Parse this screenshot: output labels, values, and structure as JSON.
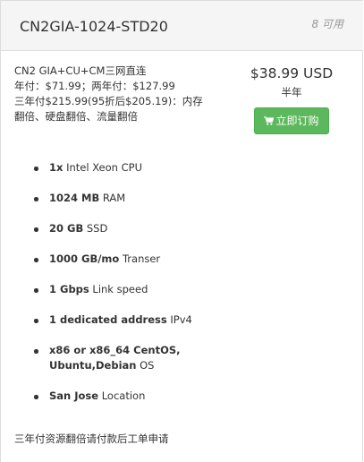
{
  "product": {
    "name": "CN2GIA-1024-STD20",
    "availability": "8 可用"
  },
  "description": {
    "lines": [
      "CN2 GIA+CU+CM三网直连",
      "年付：$71.99；两年付：$127.99",
      "三年付$215.99(95折后$205.19)：内存",
      "翻倍、硬盘翻倍、流量翻倍"
    ]
  },
  "pricing": {
    "price": "$38.99 USD",
    "cycle": "半年"
  },
  "order_button": {
    "label": "立即订购",
    "icon": "shopping-cart-icon",
    "color": "#5cb85c"
  },
  "features": [
    {
      "bold": "1x",
      "text": " Intel Xeon CPU"
    },
    {
      "bold": "1024 MB",
      "text": " RAM"
    },
    {
      "bold": "20 GB",
      "text": " SSD"
    },
    {
      "bold": "1000 GB/mo",
      "text": " Transer"
    },
    {
      "bold": "1 Gbps",
      "text": " Link speed"
    },
    {
      "bold": "1 dedicated address",
      "text": " IPv4"
    },
    {
      "bold": "x86 or x86_64 CentOS,",
      "bold2": "Ubuntu,Debian",
      "text": " OS"
    },
    {
      "bold": "San Jose",
      "text": " Location"
    }
  ],
  "footer_note": "三年付资源翻倍请付款后工单申请"
}
